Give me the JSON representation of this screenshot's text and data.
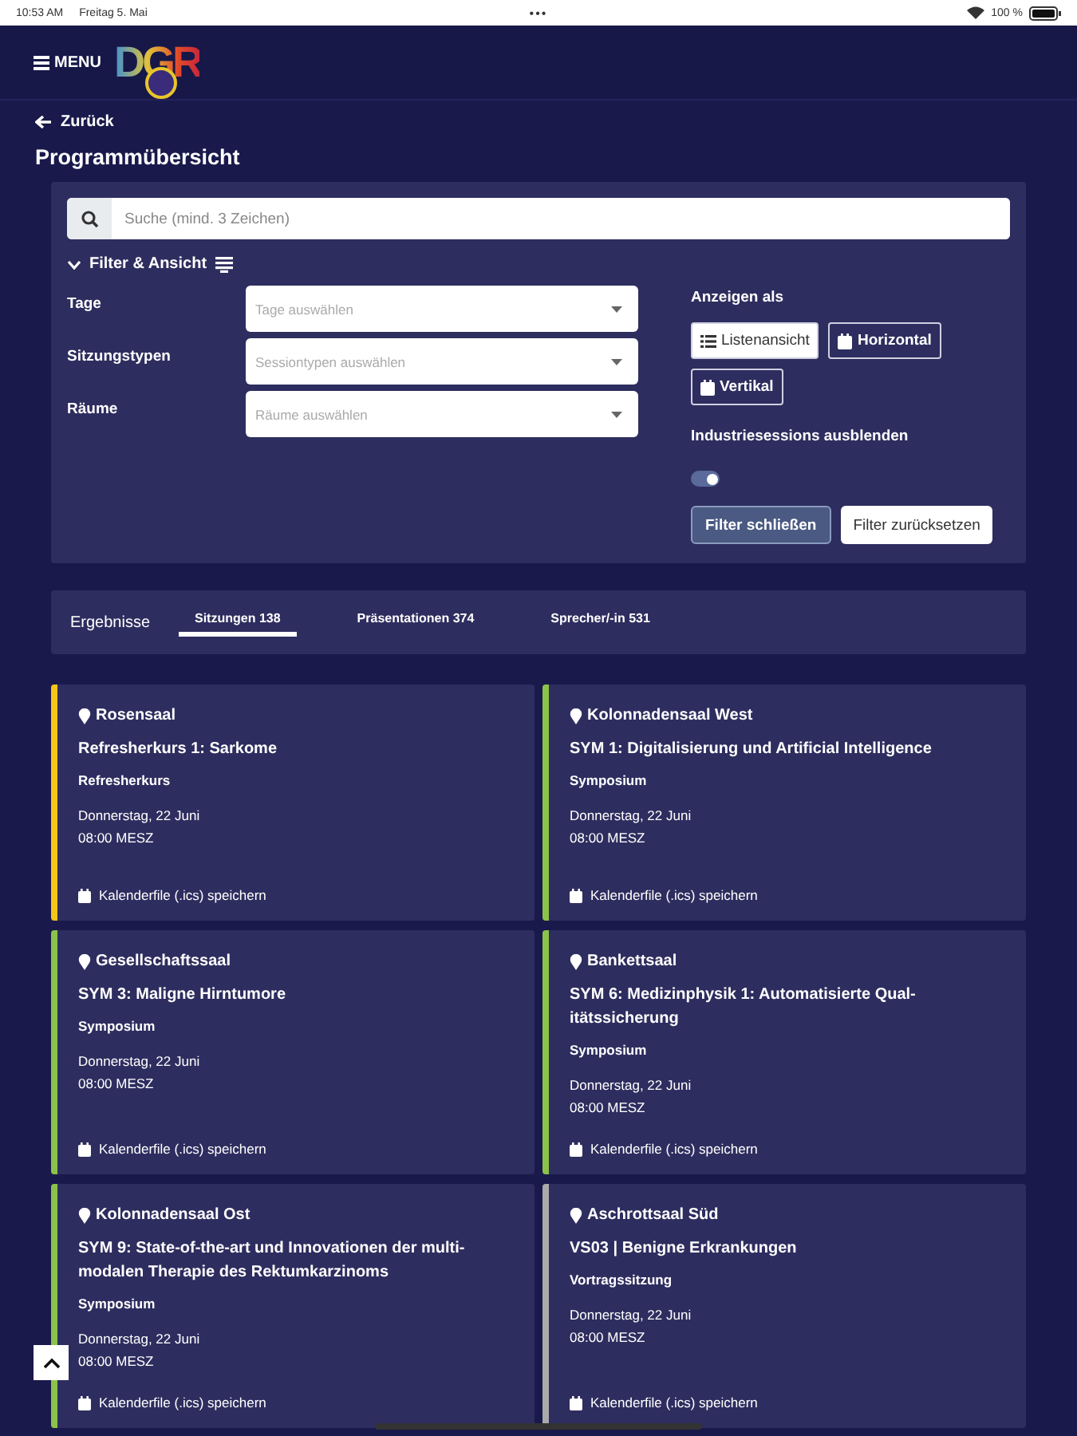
{
  "status_bar": {
    "time": "10:53 AM",
    "date": "Freitag 5. Mai",
    "dots": "•••",
    "battery": "100 %"
  },
  "header": {
    "menu": "MENU",
    "logo": "DGR"
  },
  "back": "Zurück",
  "page_title": "Programmübersicht",
  "search": {
    "placeholder": "Suche (mind. 3 Zeichen)"
  },
  "filter": {
    "title": "Filter & Ansicht",
    "expanded": true,
    "fields": [
      {
        "label": "Tage",
        "placeholder": "Tage auswählen"
      },
      {
        "label": "Sitzungstypen",
        "placeholder": "Sessiontypen auswählen"
      },
      {
        "label": "Räume",
        "placeholder": "Räume auswählen"
      }
    ],
    "view_label": "Anzeigen als",
    "views": [
      {
        "label": "Listenansicht",
        "kind": "list",
        "selected": true
      },
      {
        "label": "Horizontal",
        "kind": "calendar",
        "selected": false
      },
      {
        "label": "Vertikal",
        "kind": "calendar",
        "selected": false
      }
    ],
    "toggle": {
      "label": "Industriesessions ausblenden",
      "on": true
    },
    "buttons": [
      {
        "label": "Filter schließen",
        "kind": "primary"
      },
      {
        "label": "Filter zurücksetzen",
        "kind": "secondary"
      }
    ]
  },
  "results": {
    "label": "Ergebnisse",
    "tabs": [
      {
        "label": "Sitzungen 138",
        "selected": true
      },
      {
        "label": "Präsentationen 374",
        "selected": false
      },
      {
        "label": "Sprecher/-in 531",
        "selected": false
      }
    ]
  },
  "sessions": [
    {
      "room": "Rosensaal",
      "title": "Refresherkurs 1: Sarkome",
      "type": "Refresherkurs",
      "date": "Donnerstag, 22 Juni",
      "time": "08:00 MESZ",
      "calendar": "Kalenderfile (.ics) speichern",
      "color": "#f5c518"
    },
    {
      "room": "Kolonnadensaal West",
      "title": "SYM 1: Digitalisierung und Artificial Intelligence",
      "type": "Symposium",
      "date": "Donnerstag, 22 Juni",
      "time": "08:00 MESZ",
      "calendar": "Kalenderfile (.ics) speichern",
      "color": "#8bc34a"
    },
    {
      "room": "Gesellschaftssaal",
      "title": "SYM 3: Maligne Hirntumore",
      "type": "Symposium",
      "date": "Donnerstag, 22 Juni",
      "time": "08:00 MESZ",
      "calendar": "Kalenderfile (.ics) speichern",
      "color": "#8bc34a"
    },
    {
      "room": "Bankettsaal",
      "title": "SYM 6: Medizinphysik 1: Automatisierte Qual-itätssicherung",
      "type": "Symposium",
      "date": "Donnerstag, 22 Juni",
      "time": "08:00 MESZ",
      "calendar": "Kalenderfile (.ics) speichern",
      "color": "#8bc34a"
    },
    {
      "room": "Kolonnadensaal Ost",
      "title": "SYM 9: State-of-the-art und Innovationen der multi-modalen Therapie des Rektumkarzinoms",
      "type": "Symposium",
      "date": "Donnerstag, 22 Juni",
      "time": "08:00 MESZ",
      "calendar": "Kalenderfile (.ics) speichern",
      "color": "#8bc34a"
    },
    {
      "room": "Aschrottsaal Süd",
      "title": "VS03 | Benigne Erkrankungen",
      "type": "Vortragssitzung",
      "date": "Donnerstag, 22 Juni",
      "time": "08:00 MESZ",
      "calendar": "Kalenderfile (.ics) speichern",
      "color": "#aaaaaa"
    }
  ]
}
